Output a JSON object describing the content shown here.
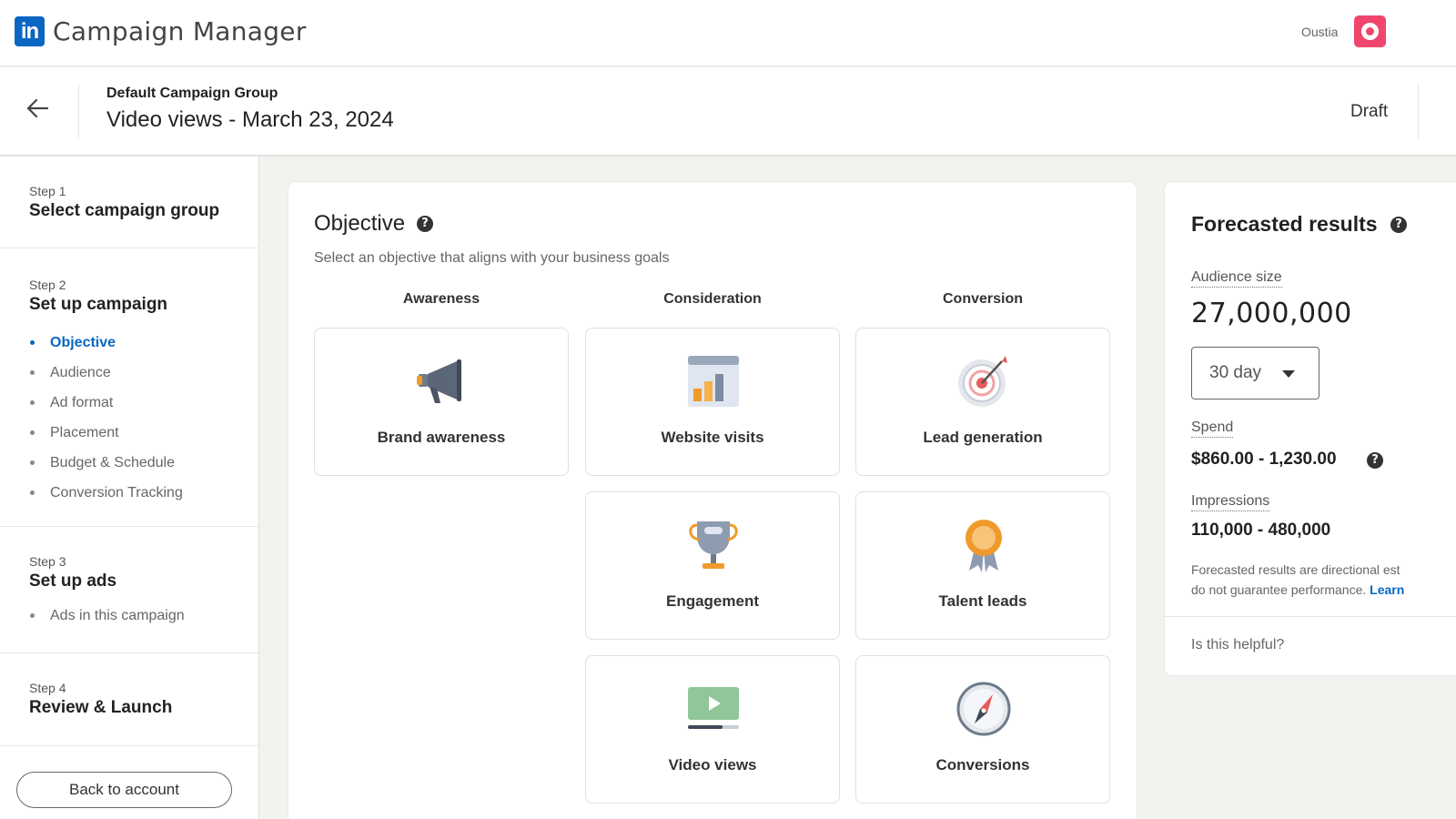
{
  "topbar": {
    "logo_text": "in",
    "app_title": "Campaign Manager",
    "account_name": "Oustia"
  },
  "header": {
    "group_name": "Default Campaign Group",
    "campaign_name": "Video views - March 23, 2024",
    "status": "Draft"
  },
  "sidebar": {
    "steps": [
      {
        "label": "Step 1",
        "title": "Select campaign group",
        "items": []
      },
      {
        "label": "Step 2",
        "title": "Set up campaign",
        "items": [
          "Objective",
          "Audience",
          "Ad format",
          "Placement",
          "Budget & Schedule",
          "Conversion Tracking"
        ]
      },
      {
        "label": "Step 3",
        "title": "Set up ads",
        "items": [
          "Ads in this campaign"
        ]
      },
      {
        "label": "Step 4",
        "title": "Review & Launch",
        "items": []
      }
    ],
    "active_item": "Objective",
    "back_button": "Back to account"
  },
  "objective": {
    "title": "Objective",
    "subtitle": "Select an objective that aligns with your business goals",
    "columns": [
      "Awareness",
      "Consideration",
      "Conversion"
    ],
    "tiles": {
      "brand_awareness": "Brand awareness",
      "website_visits": "Website visits",
      "lead_generation": "Lead generation",
      "engagement": "Engagement",
      "talent_leads": "Talent leads",
      "video_views": "Video views",
      "conversions": "Conversions"
    }
  },
  "forecast": {
    "title": "Forecasted results",
    "audience_label": "Audience size",
    "audience_value": "27,000,000",
    "period": "30 day",
    "spend_label": "Spend",
    "spend_value": "$860.00 - 1,230.00",
    "impressions_label": "Impressions",
    "impressions_value": "110,000 - 480,000",
    "note_line1": "Forecasted results are directional est",
    "note_line2": "do not guarantee performance.",
    "learn_link": "Learn",
    "helpful": "Is this helpful?"
  },
  "help_glyph": "?",
  "colors": {
    "linkedin_blue": "#0a66c2",
    "account_pink": "#f0466e"
  }
}
